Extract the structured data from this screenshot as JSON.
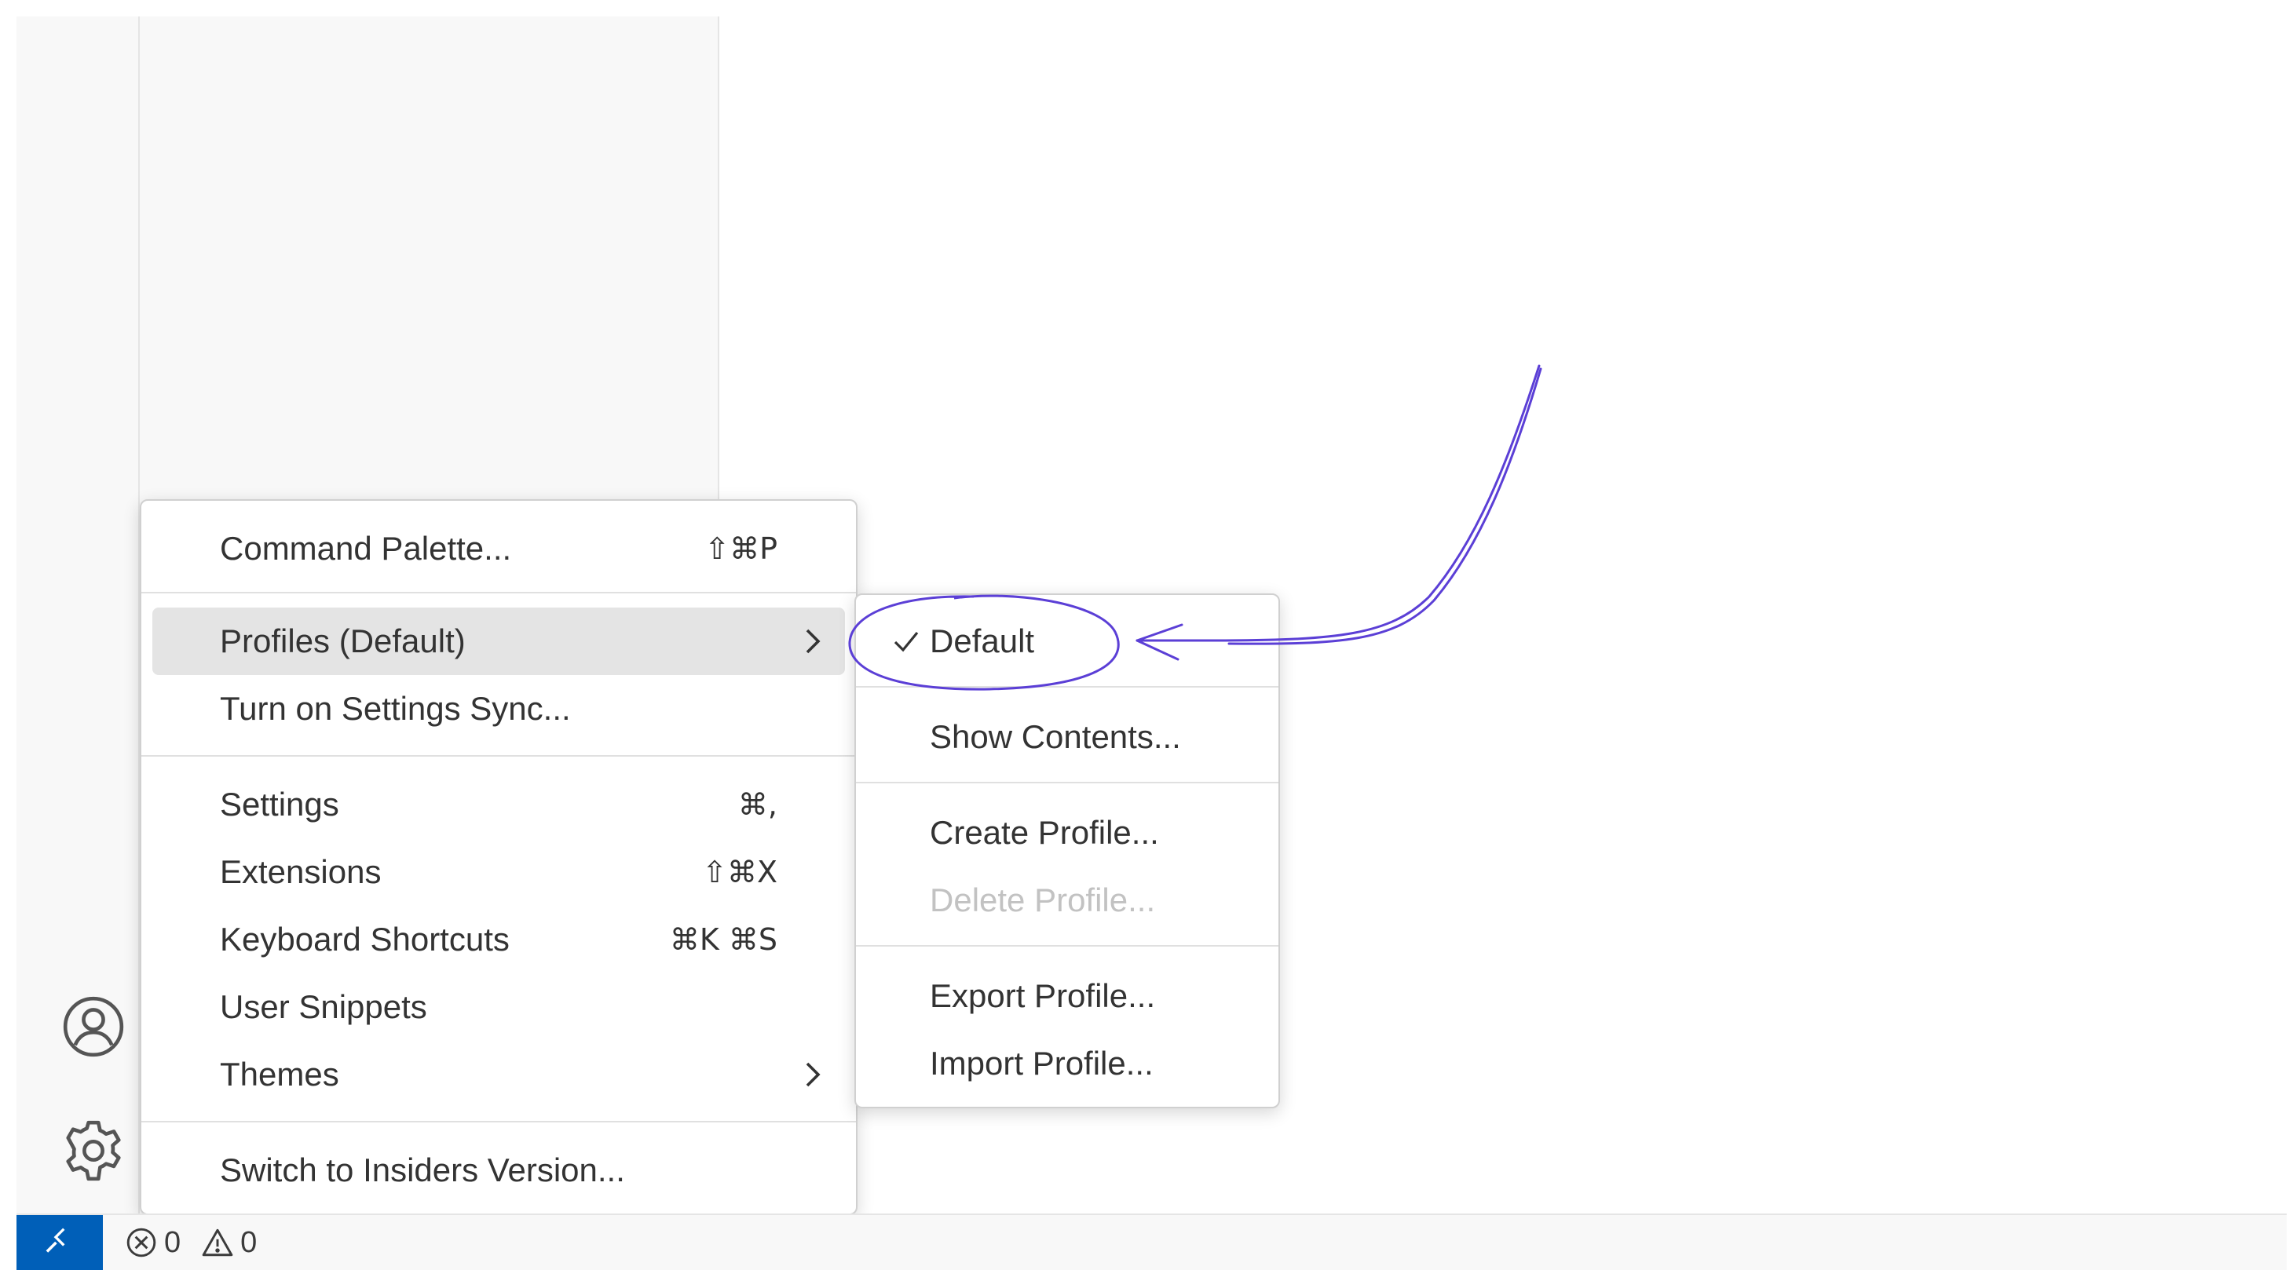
{
  "main_menu": {
    "items": [
      {
        "label": "Command Palette...",
        "keys": "⇧⌘P"
      },
      {
        "label": "Profiles (Default)",
        "keys": ""
      },
      {
        "label": "Turn on Settings Sync...",
        "keys": ""
      },
      {
        "label": "Settings",
        "keys": "⌘,"
      },
      {
        "label": "Extensions",
        "keys": "⇧⌘X"
      },
      {
        "label": "Keyboard Shortcuts",
        "keys": "⌘K ⌘S"
      },
      {
        "label": "User Snippets",
        "keys": ""
      },
      {
        "label": "Themes",
        "keys": ""
      },
      {
        "label": "Switch to Insiders Version...",
        "keys": ""
      }
    ]
  },
  "profiles_submenu": {
    "items": [
      {
        "label": "Default",
        "checked": true
      },
      {
        "label": "Show Contents..."
      },
      {
        "label": "Create Profile..."
      },
      {
        "label": "Delete Profile...",
        "disabled": true
      },
      {
        "label": "Export Profile..."
      },
      {
        "label": "Import Profile..."
      }
    ]
  },
  "status_bar": {
    "errors": "0",
    "warnings": "0"
  },
  "colors": {
    "accent": "#005fb8",
    "annotation": "#5b3fd6",
    "menu_highlight": "#e4e4e4"
  },
  "icons": {
    "activity_bar": [
      "account-icon",
      "gear-icon"
    ],
    "status_bar": [
      "remote-icon",
      "error-icon",
      "warning-icon"
    ]
  }
}
